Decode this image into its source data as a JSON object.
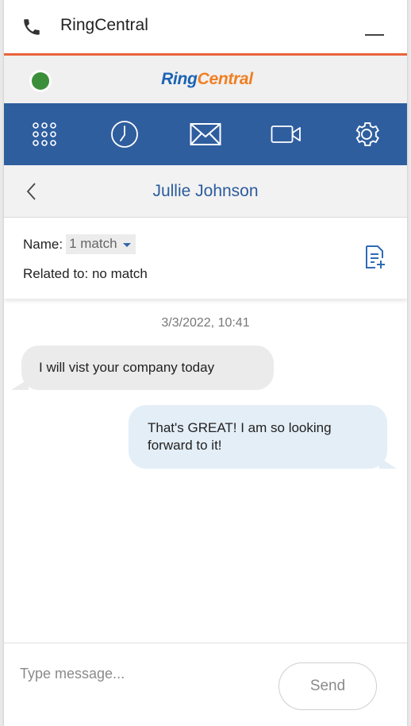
{
  "window": {
    "title": "RingCentral"
  },
  "brand": {
    "logo_part1": "Ring",
    "logo_part2": "Central",
    "status_color": "#3b8f3b"
  },
  "nav": {
    "items": [
      {
        "icon": "dialpad-icon"
      },
      {
        "icon": "history-clock-icon"
      },
      {
        "icon": "messages-envelope-icon"
      },
      {
        "icon": "video-camera-icon"
      },
      {
        "icon": "settings-gear-icon"
      }
    ],
    "background": "#2f5e9f"
  },
  "conversation": {
    "title": "Jullie Johnson",
    "name_label": "Name:",
    "name_match": "1 match",
    "related_label": "Related to: no match"
  },
  "messages": {
    "timestamp": "3/3/2022, 10:41",
    "items": [
      {
        "direction": "incoming",
        "text": "I will vist your company today"
      },
      {
        "direction": "outgoing",
        "text": "That's GREAT! I am so looking forward to it!"
      }
    ]
  },
  "composer": {
    "placeholder": "Type message...",
    "send_label": "Send"
  },
  "colors": {
    "accent": "#e8643c",
    "title_blue": "#2c5c9c",
    "outgoing_bubble": "#e4eef7",
    "incoming_bubble": "#ebebeb"
  }
}
